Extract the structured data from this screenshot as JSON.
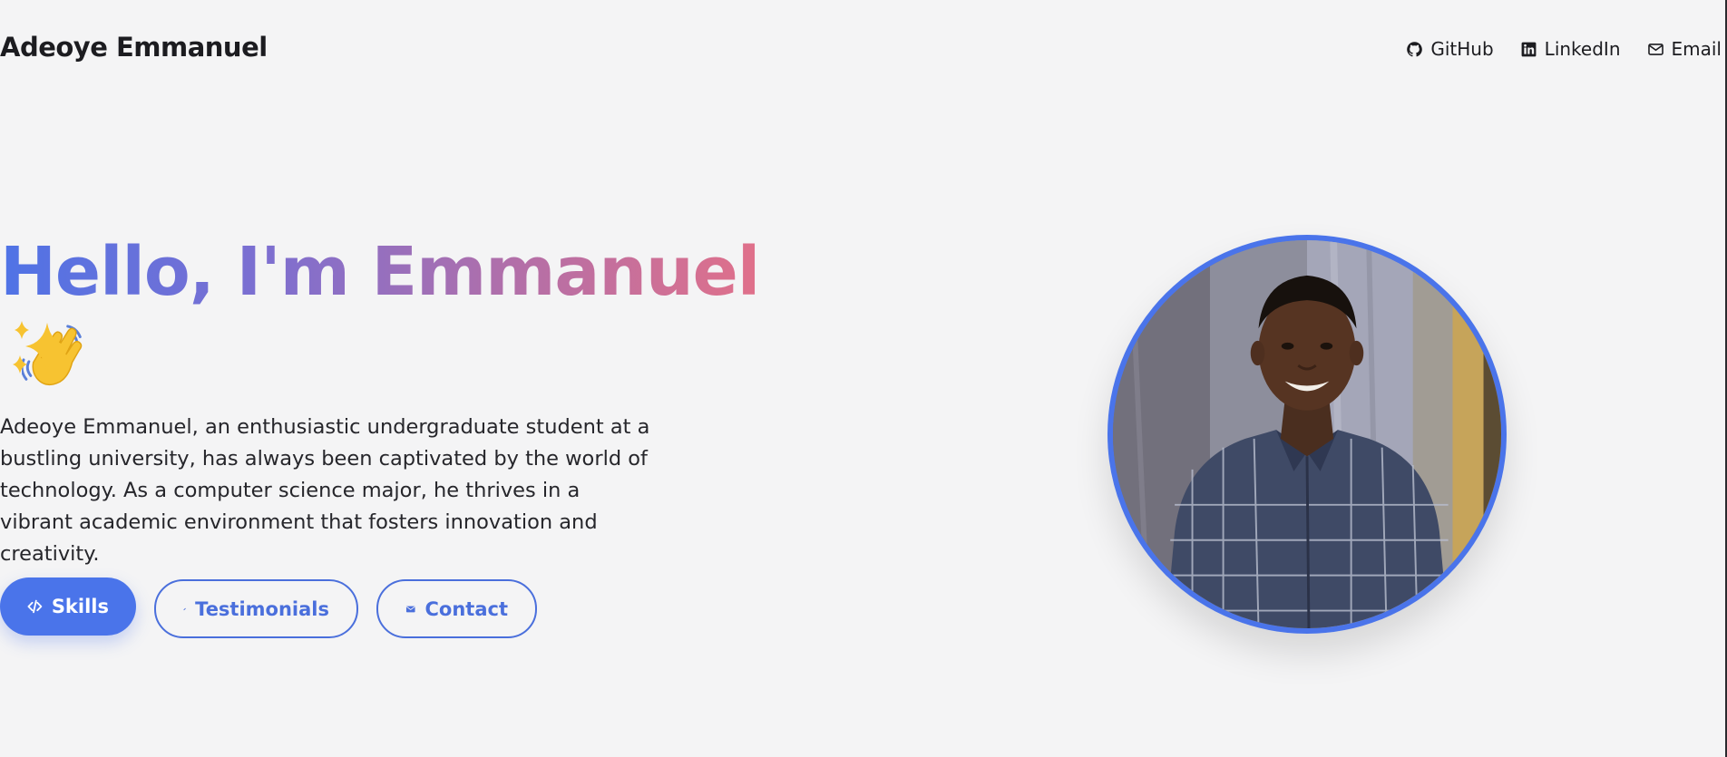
{
  "header": {
    "brand": "Adeoye Emmanuel",
    "nav": [
      {
        "label": "GitHub",
        "icon": "github-icon"
      },
      {
        "label": "LinkedIn",
        "icon": "linkedin-icon"
      },
      {
        "label": "Email",
        "icon": "mail-icon"
      }
    ]
  },
  "hero": {
    "title": "Hello, I'm Emmanuel",
    "title_emoji": "waving-hand-icon",
    "sparkle_emoji": "sparkles-icon",
    "bio": "Adeoye Emmanuel, an enthusiastic undergraduate student at a bustling university, has always been captivated by the world of technology. As a computer science major, he thrives in a vibrant academic environment that fosters innovation and creativity.",
    "buttons": [
      {
        "label": "Skills",
        "icon": "code-icon",
        "style": "primary"
      },
      {
        "label": "Testimonials",
        "icon": "pencil-icon",
        "style": "outline"
      },
      {
        "label": "Contact",
        "icon": "envelope-icon",
        "style": "outline"
      }
    ]
  },
  "profile_photo": {
    "alt": "profile-photo"
  },
  "colors": {
    "accent": "#4a74ea",
    "gradient_start": "#4f73e6",
    "gradient_end": "#e0708a",
    "background": "#f4f4f5"
  }
}
